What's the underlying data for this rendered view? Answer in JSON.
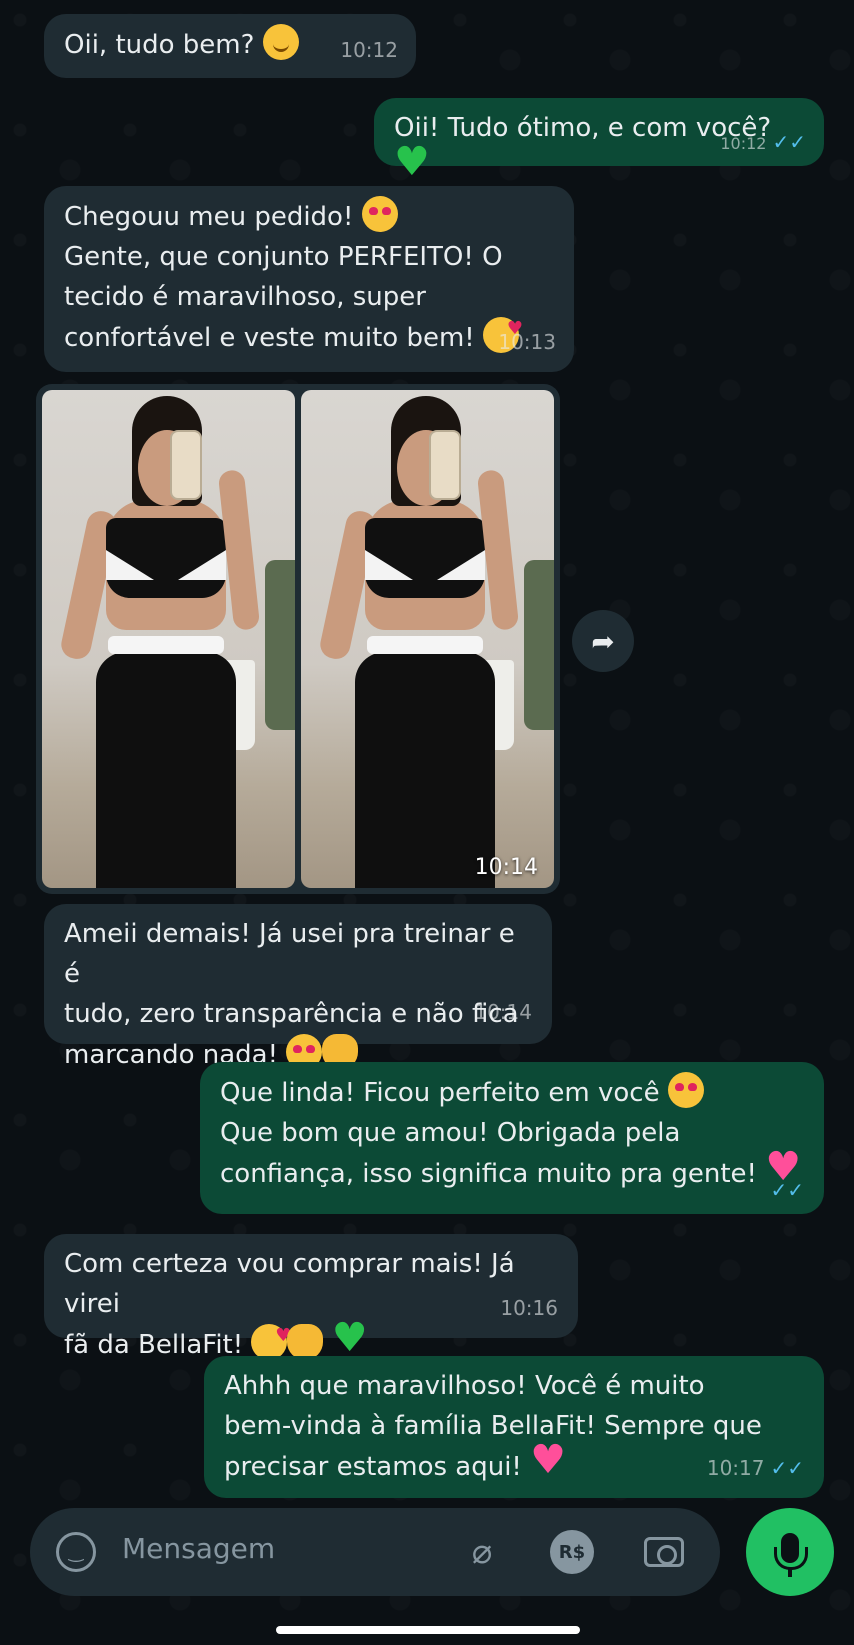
{
  "messages": [
    {
      "id": "m1",
      "direction": "in",
      "text": "Oii, tudo bem?",
      "time": "10:12"
    },
    {
      "id": "m2",
      "direction": "out",
      "text": "Oii! Tudo ótimo, e com você?",
      "time": "10:12",
      "status": "✓✓"
    },
    {
      "id": "m3",
      "direction": "in",
      "lines": [
        "Chegouu meu pedido!",
        "Gente, que conjunto PERFEITO! O",
        "tecido é maravilhoso, super",
        "confortável e veste muito bem!"
      ],
      "time": "10:13"
    },
    {
      "id": "m4",
      "direction": "in",
      "type": "photos",
      "count": 2,
      "time": "10:14"
    },
    {
      "id": "m5",
      "direction": "in",
      "lines": [
        "Ameii demais! Já usei pra treinar e é",
        "tudo, zero transparência e não fica",
        "marcando nada!"
      ],
      "time": "10:14"
    },
    {
      "id": "m6",
      "direction": "out",
      "lines": [
        "Que linda! Ficou perfeito em você",
        "Que bom que amou! Obrigada pela",
        "confiança, isso significa muito pra gente!"
      ],
      "time": "",
      "status": "✓✓"
    },
    {
      "id": "m7",
      "direction": "in",
      "lines": [
        "Com certeza vou comprar mais! Já virei",
        "fã da BellaFit!"
      ],
      "time": "10:16"
    },
    {
      "id": "m8",
      "direction": "out",
      "lines": [
        "Ahhh que maravilhoso! Você é muito",
        "bem-vinda à família BellaFit! Sempre que",
        "precisar estamos aqui!"
      ],
      "time": "10:17",
      "status": "✓✓"
    }
  ],
  "composer": {
    "placeholder": "Mensagem",
    "currency_label": "R$"
  },
  "icons": {
    "forward": "forward-icon",
    "emoji": "emoji-icon",
    "attach": "paperclip-icon",
    "payment": "payment-icon",
    "camera": "camera-icon",
    "mic": "microphone-icon"
  },
  "colors": {
    "incoming_bubble": "#1f2c33",
    "outgoing_bubble": "#0c4a36",
    "read_ticks": "#53bdeb",
    "mic_button": "#21c063",
    "background": "#0b1014"
  }
}
